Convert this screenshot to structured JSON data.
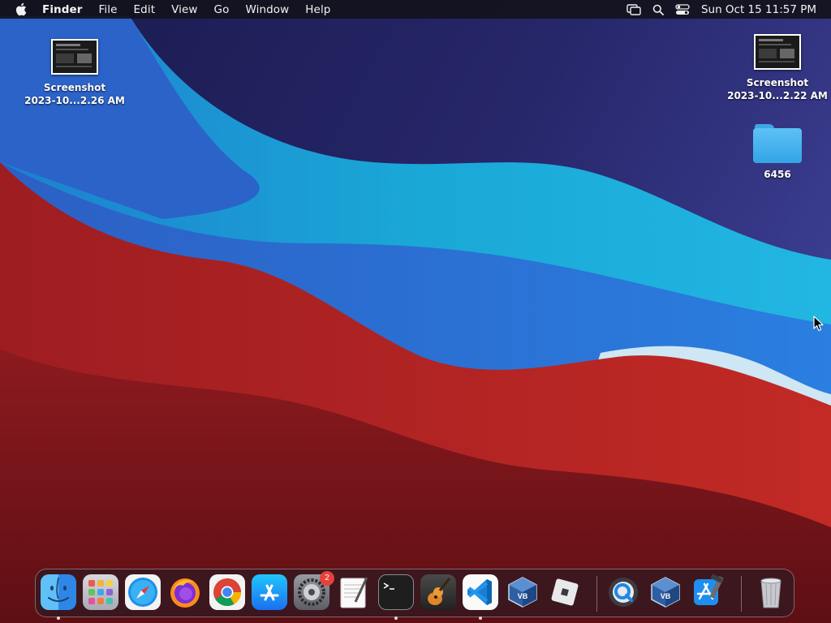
{
  "menubar": {
    "app_name": "Finder",
    "menus": [
      "File",
      "Edit",
      "View",
      "Go",
      "Window",
      "Help"
    ],
    "status_icons": [
      "screen-mirroring-icon",
      "spotlight-search-icon",
      "control-center-icon"
    ],
    "clock": "Sun Oct 15  11:57 PM"
  },
  "desktop": {
    "items": [
      {
        "kind": "screenshot",
        "line1": "Screenshot",
        "line2": "2023-10...2.26 AM"
      },
      {
        "kind": "screenshot",
        "line1": "Screenshot",
        "line2": "2023-10...2.22 AM"
      },
      {
        "kind": "folder",
        "line1": "6456"
      }
    ]
  },
  "dock": {
    "apps": [
      {
        "name": "Finder",
        "icon": "finder-icon",
        "running": true
      },
      {
        "name": "Launchpad",
        "icon": "launchpad-icon",
        "running": false
      },
      {
        "name": "Safari",
        "icon": "safari-icon",
        "running": false
      },
      {
        "name": "Firefox",
        "icon": "firefox-icon",
        "running": false
      },
      {
        "name": "Google Chrome",
        "icon": "chrome-icon",
        "running": false
      },
      {
        "name": "App Store",
        "icon": "app-store-icon",
        "running": false
      },
      {
        "name": "System Settings",
        "icon": "system-settings-icon",
        "running": false,
        "badge": "2"
      },
      {
        "name": "TextEdit",
        "icon": "textedit-icon",
        "running": false
      },
      {
        "name": "Terminal",
        "icon": "terminal-icon",
        "running": true
      },
      {
        "name": "GarageBand",
        "icon": "garageband-icon",
        "running": false
      },
      {
        "name": "Visual Studio Code",
        "icon": "vscode-icon",
        "running": true
      },
      {
        "name": "VirtualBox",
        "icon": "virtualbox-icon",
        "running": false
      },
      {
        "name": "Roblox",
        "icon": "roblox-icon",
        "running": false
      },
      {
        "name": "QuickTime Player",
        "icon": "quicktime-icon",
        "running": false
      },
      {
        "name": "VirtualBox",
        "icon": "virtualbox-icon",
        "running": false
      },
      {
        "name": "Xcode",
        "icon": "xcode-icon",
        "running": false
      },
      {
        "name": "Trash",
        "icon": "trash-icon",
        "running": false
      }
    ]
  },
  "colors": {
    "wallpaper_navy": "#23235a",
    "wallpaper_blue": "#2a6fd6",
    "wallpaper_cyan": "#19a6d6",
    "wallpaper_red": "#b3201f",
    "folder_blue": "#4cb6f0",
    "badge_red": "#e8403a"
  }
}
